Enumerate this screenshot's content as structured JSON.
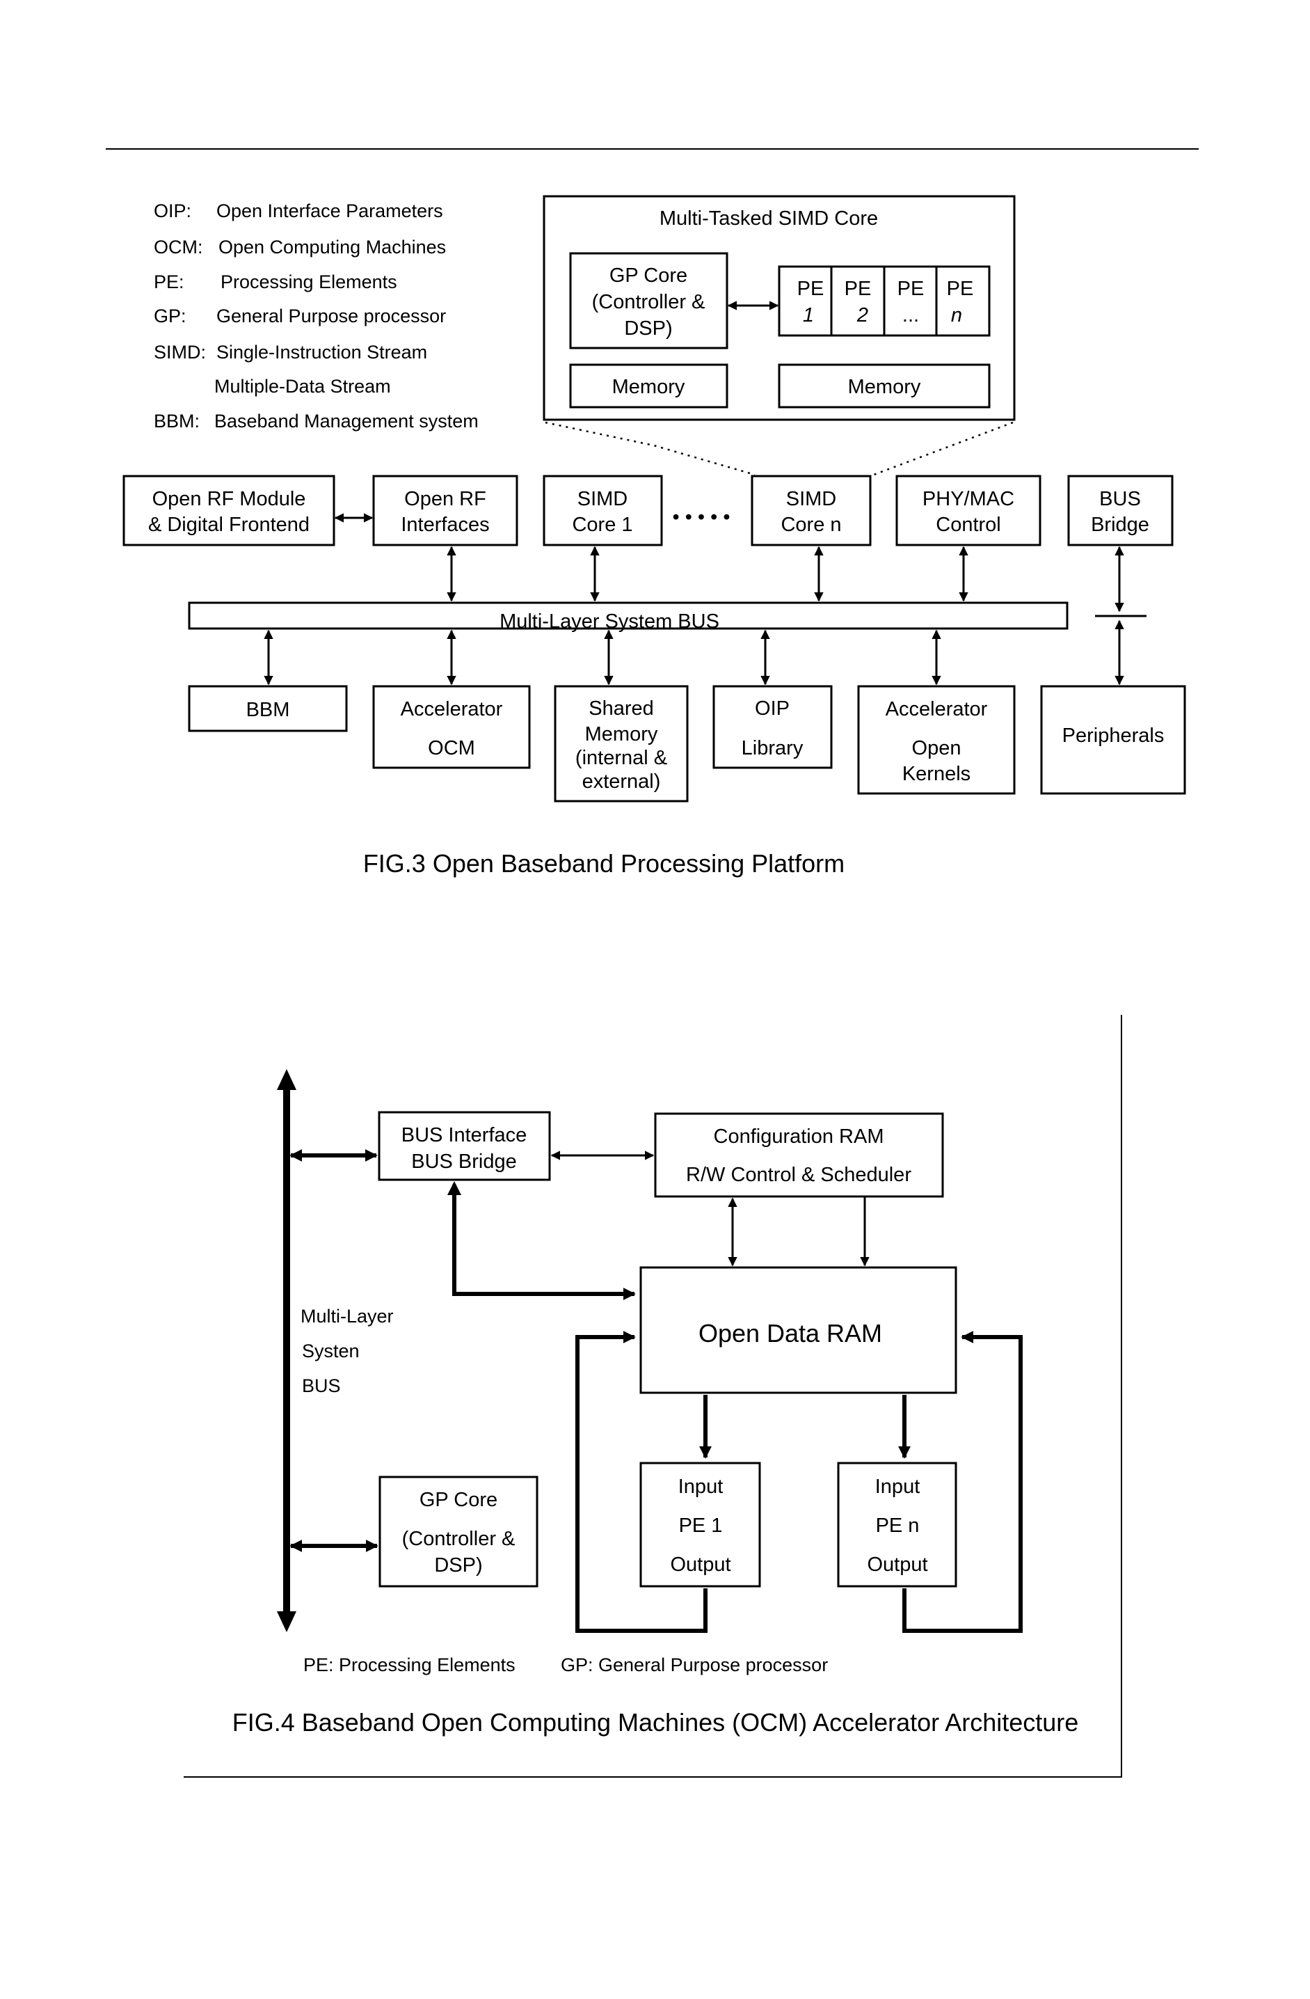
{
  "fig3": {
    "legend": [
      {
        "abbr": "OIP:",
        "text": "Open Interface Parameters"
      },
      {
        "abbr": "OCM:",
        "text": "Open Computing Machines"
      },
      {
        "abbr": "PE:",
        "text": "Processing Elements"
      },
      {
        "abbr": "GP:",
        "text": "General Purpose processor"
      },
      {
        "abbr": "SIMD:",
        "text": "Single-Instruction Stream"
      },
      {
        "abbr": "",
        "text": "Multiple-Data Stream"
      },
      {
        "abbr": "BBM:",
        "text": "Baseband Management system"
      }
    ],
    "simd_detail": {
      "title": "Multi-Tasked SIMD Core",
      "gp_core": [
        "GP Core",
        "(Controller &",
        "DSP)"
      ],
      "pe_cells": [
        {
          "top": "PE",
          "bottom": "1"
        },
        {
          "top": "PE",
          "bottom": "2"
        },
        {
          "top": "PE",
          "bottom": "..."
        },
        {
          "top": "PE",
          "bottom": "n"
        }
      ],
      "memory_left": "Memory",
      "memory_right": "Memory"
    },
    "top_row": [
      [
        "Open RF Module",
        "& Digital Frontend"
      ],
      [
        "Open RF",
        "Interfaces"
      ],
      [
        "SIMD",
        "Core 1"
      ],
      [
        "SIMD",
        "Core n"
      ],
      [
        "PHY/MAC",
        "Control"
      ],
      [
        "BUS",
        "Bridge"
      ]
    ],
    "ellipsis": "• • • • •",
    "bus_label": "Multi-Layer System BUS",
    "bottom_row": [
      [
        "BBM"
      ],
      [
        "Accelerator",
        "OCM"
      ],
      [
        "Shared",
        "Memory",
        "(internal &",
        "external)"
      ],
      [
        "OIP",
        "Library"
      ],
      [
        "Accelerator",
        "Open",
        "Kernels"
      ],
      [
        "Peripherals"
      ]
    ],
    "caption": "FIG.3  Open Baseband Processing Platform"
  },
  "fig4": {
    "bus_interface": [
      "BUS Interface",
      "BUS Bridge"
    ],
    "config_ram": [
      "Configuration RAM",
      "R/W Control & Scheduler"
    ],
    "open_data_ram": "Open Data RAM",
    "bus_label": [
      "Multi-Layer",
      "Systen",
      "BUS"
    ],
    "gp_core": [
      "GP Core",
      "(Controller &",
      "DSP)"
    ],
    "pe1": [
      "Input",
      "PE 1",
      "Output"
    ],
    "pen": [
      "Input",
      "PE n",
      "Output"
    ],
    "legend_pe": "PE: Processing Elements",
    "legend_gp": "GP: General Purpose processor",
    "caption": "FIG.4 Baseband Open Computing Machines (OCM) Accelerator Architecture"
  }
}
